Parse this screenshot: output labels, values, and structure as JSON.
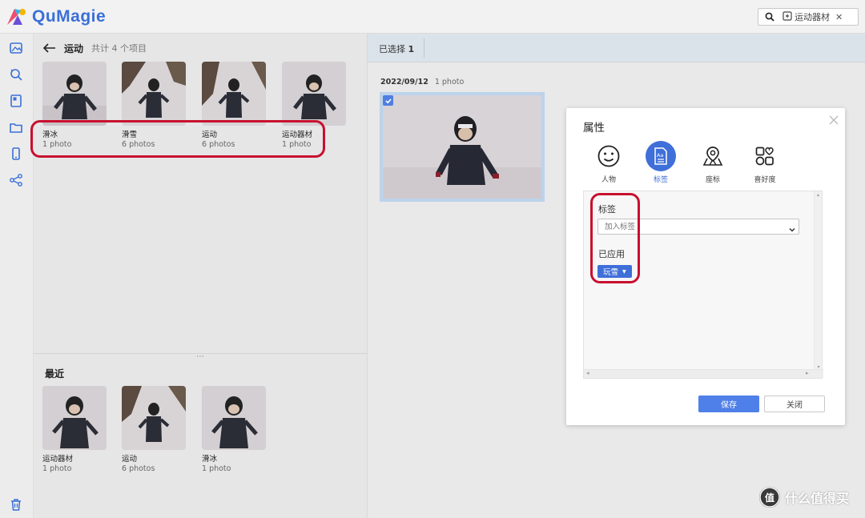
{
  "app": {
    "name": "QuMagie",
    "brand_color": "#3a6fd8",
    "search_chip": "运动器材"
  },
  "left_panel": {
    "title": "运动",
    "count": "共计 4 个项目",
    "albums": [
      {
        "name": "滑冰",
        "sub": "1 photo"
      },
      {
        "name": "滑雪",
        "sub": "6 photos"
      },
      {
        "name": "运动",
        "sub": "6 photos"
      },
      {
        "name": "运动器材",
        "sub": "1 photo"
      }
    ],
    "recent_title": "最近",
    "recent": [
      {
        "name": "运动器材",
        "sub": "1 photo"
      },
      {
        "name": "运动",
        "sub": "6 photos"
      },
      {
        "name": "滑冰",
        "sub": "1 photo"
      }
    ]
  },
  "content": {
    "selected_label": "已选择",
    "selected_count": "1",
    "date": "2022/09/12",
    "date_count": "1 photo"
  },
  "modal": {
    "title": "属性",
    "tabs": [
      {
        "label": "人物",
        "icon": "face-icon"
      },
      {
        "label": "标签",
        "icon": "tag-icon"
      },
      {
        "label": "座标",
        "icon": "map-pin-icon"
      },
      {
        "label": "喜好度",
        "icon": "favorites-icon"
      }
    ],
    "active_tab": "标签",
    "tag_label": "标签",
    "tag_placeholder": "加入标签",
    "applied_label": "已应用",
    "applied_tag": "玩雪",
    "save": "保存",
    "close": "关闭"
  },
  "watermark": "什么值得买",
  "colors": {
    "highlight": "#c8102e",
    "primary": "#3f6fd8"
  }
}
